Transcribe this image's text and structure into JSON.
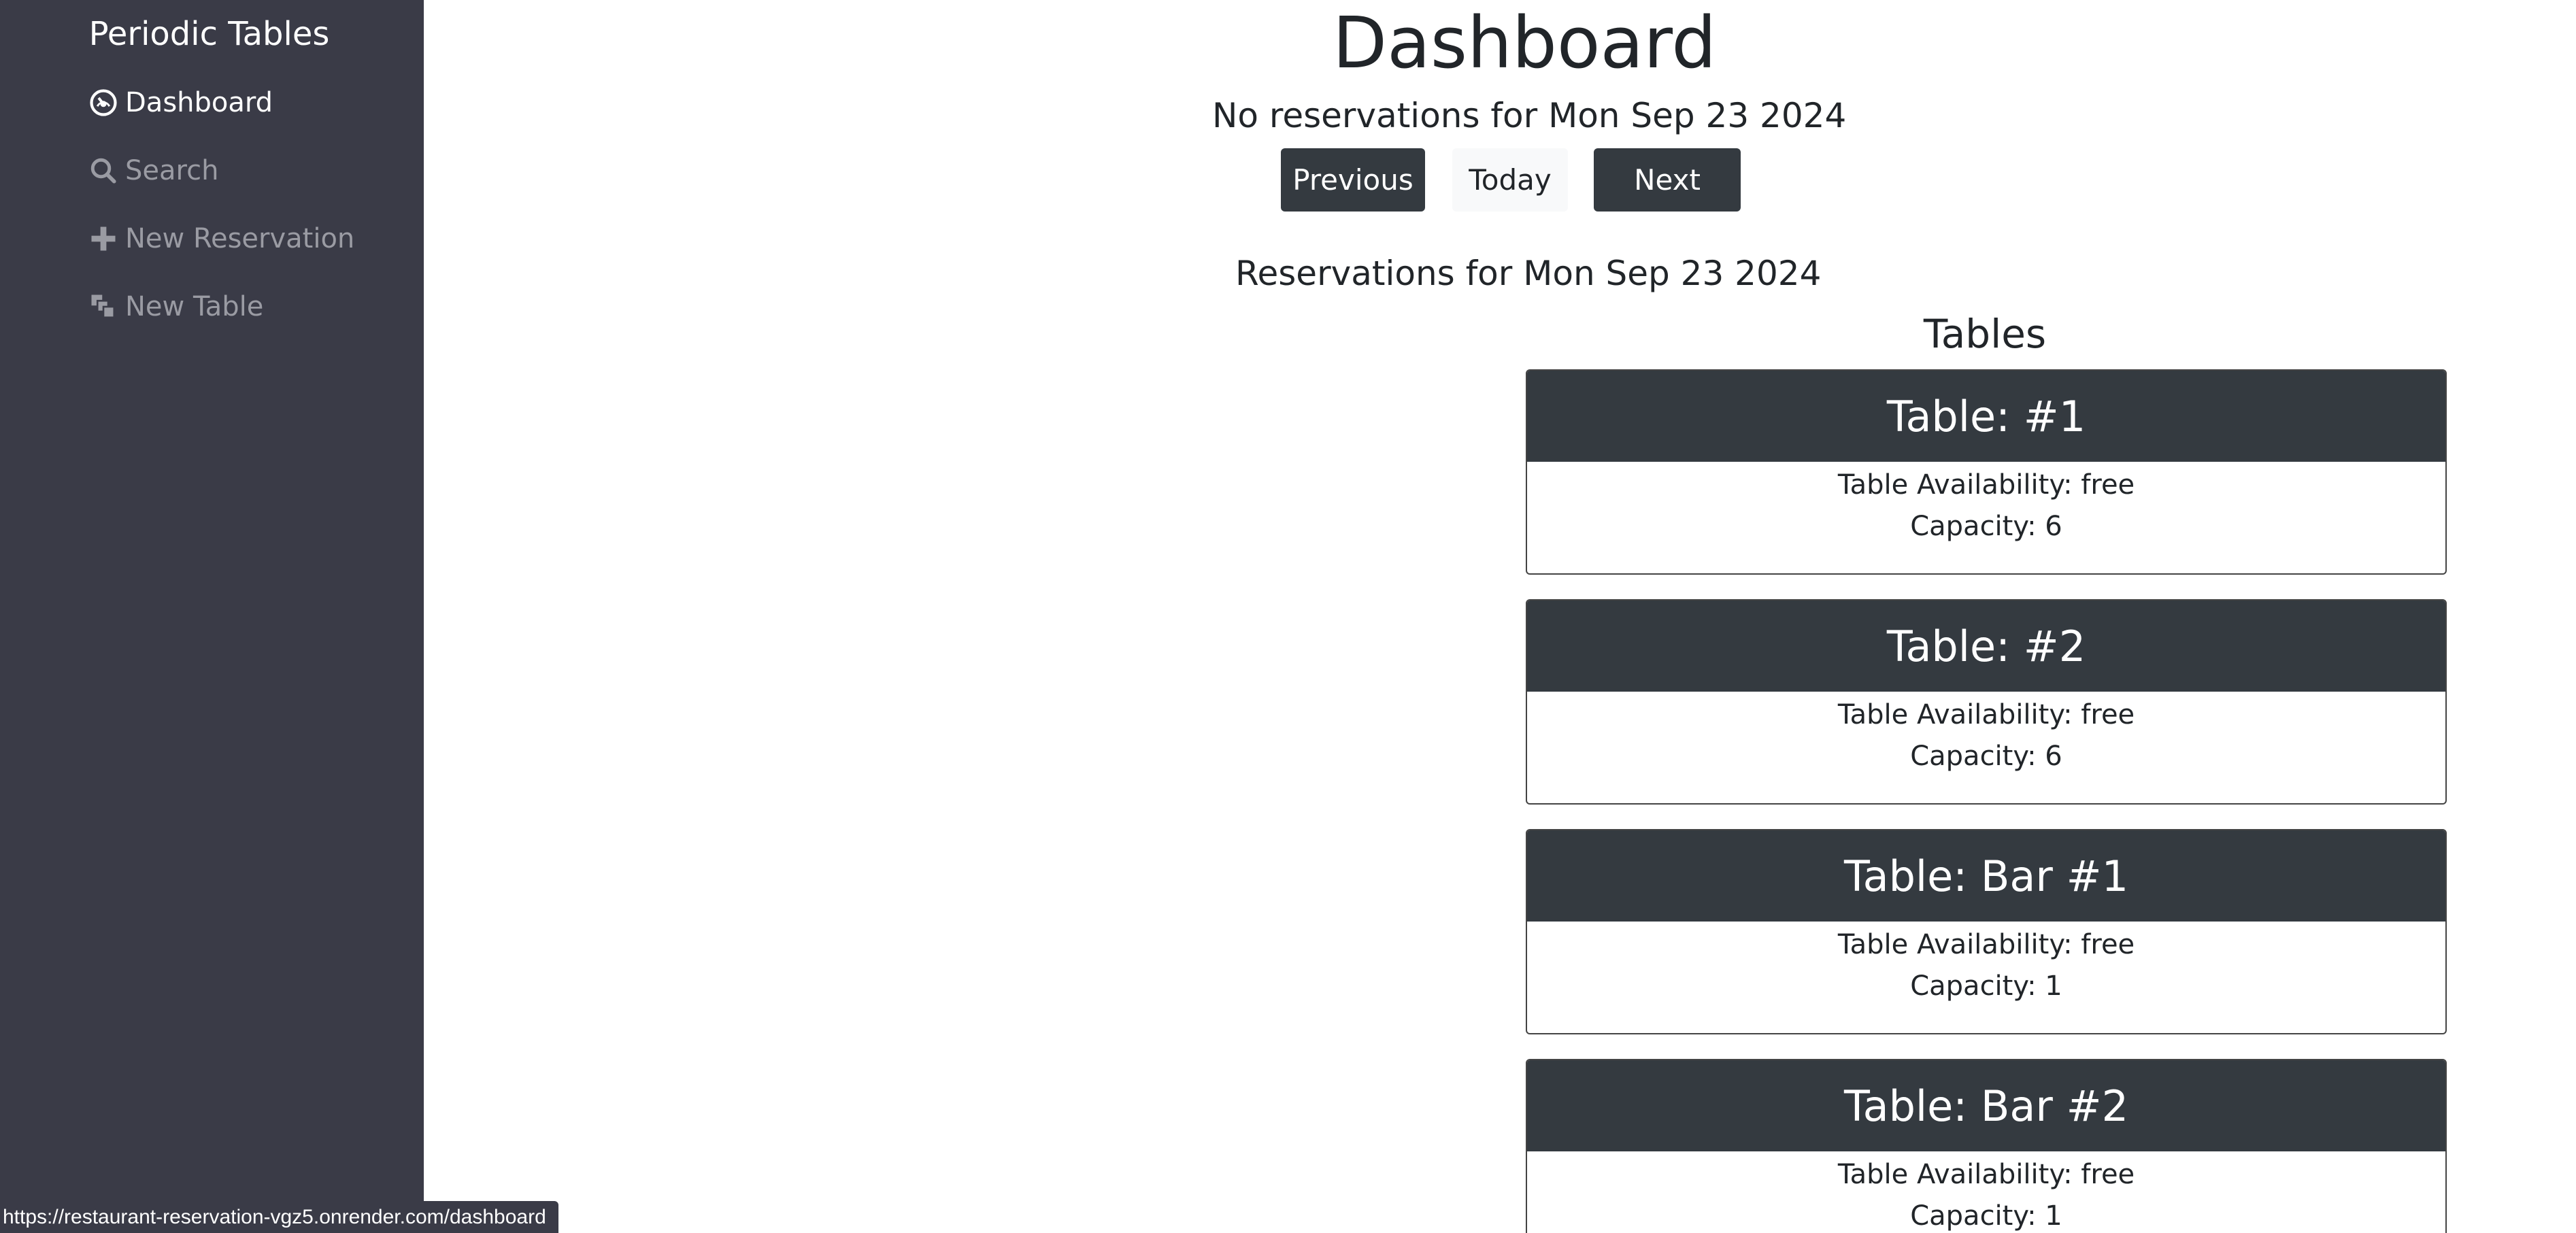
{
  "sidebar": {
    "brand": "Periodic Tables",
    "items": [
      {
        "label": "Dashboard",
        "icon": "dashboard-icon",
        "active": true
      },
      {
        "label": "Search",
        "icon": "search-icon",
        "active": false
      },
      {
        "label": "New Reservation",
        "icon": "plus-icon",
        "active": false
      },
      {
        "label": "New Table",
        "icon": "new-table-icon",
        "active": false
      }
    ]
  },
  "main": {
    "title": "Dashboard",
    "no_reservations": "No reservations for Mon Sep 23 2024",
    "buttons": {
      "previous": "Previous",
      "today": "Today",
      "next": "Next"
    },
    "reservations_heading": "Reservations for Mon Sep 23 2024",
    "tables_heading": "Tables",
    "tables": [
      {
        "name": "Table: #1",
        "availability": "Table Availability: free",
        "capacity": "Capacity: 6"
      },
      {
        "name": "Table: #2",
        "availability": "Table Availability: free",
        "capacity": "Capacity: 6"
      },
      {
        "name": "Table: Bar #1",
        "availability": "Table Availability: free",
        "capacity": "Capacity: 1"
      },
      {
        "name": "Table: Bar #2",
        "availability": "Table Availability: free",
        "capacity": "Capacity: 1"
      }
    ]
  },
  "status_bar": {
    "url": "https://restaurant-reservation-vgz5.onrender.com/dashboard"
  },
  "colors": {
    "sidebar_bg": "#3a3b47",
    "dark": "#343a40",
    "light": "#f8f9fa"
  }
}
